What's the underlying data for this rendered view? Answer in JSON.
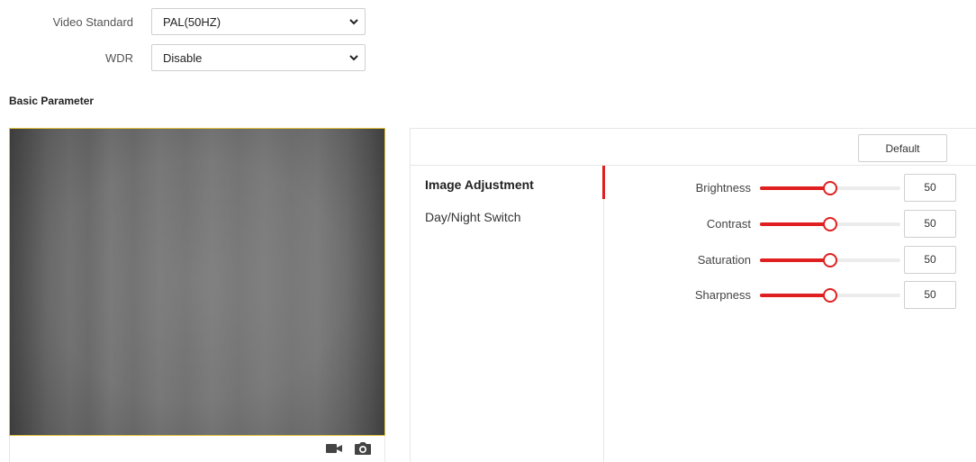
{
  "settings": {
    "video_standard": {
      "label": "Video Standard",
      "value": "PAL(50HZ)"
    },
    "wdr": {
      "label": "WDR",
      "value": "Disable"
    }
  },
  "section_title": "Basic Parameter",
  "preview": {
    "toolbar_icons": [
      "video-camera-icon",
      "camera-icon"
    ]
  },
  "panel": {
    "default_label": "Default",
    "tabs": [
      {
        "label": "Image Adjustment",
        "active": true
      },
      {
        "label": "Day/Night Switch",
        "active": false
      }
    ],
    "sliders": [
      {
        "label": "Brightness",
        "value": "50",
        "fraction": 0.5
      },
      {
        "label": "Contrast",
        "value": "50",
        "fraction": 0.5
      },
      {
        "label": "Saturation",
        "value": "50",
        "fraction": 0.5
      },
      {
        "label": "Sharpness",
        "value": "50",
        "fraction": 0.5
      }
    ]
  },
  "colors": {
    "accent": "#e02020",
    "preview_border": "#e3c23a"
  }
}
